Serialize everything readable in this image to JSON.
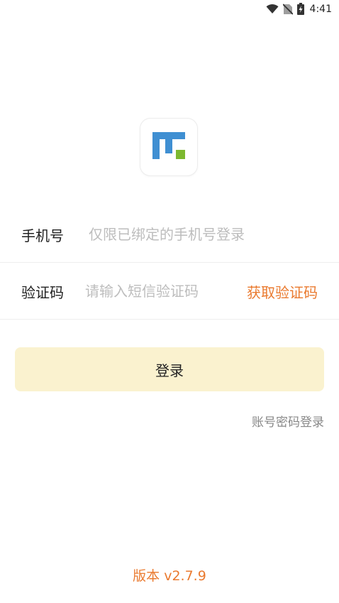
{
  "status_bar": {
    "time": "4:41",
    "icons": [
      "wifi-icon",
      "no-sim-icon",
      "battery-charging-icon"
    ]
  },
  "logo": {
    "icon": "app-logo-icon",
    "colors": {
      "blue": "#3f8fd2",
      "green": "#7cb82f"
    }
  },
  "form": {
    "phone": {
      "label": "手机号",
      "placeholder": "仅限已绑定的手机号登录",
      "value": ""
    },
    "code": {
      "label": "验证码",
      "placeholder": "请输入短信验证码",
      "value": "",
      "get_code_label": "获取验证码"
    }
  },
  "login_button": {
    "label": "登录",
    "color": "#faf2cf"
  },
  "alt_login_label": "账号密码登录",
  "version": "版本 v2.7.9",
  "accent_color": "#ea7a2f"
}
